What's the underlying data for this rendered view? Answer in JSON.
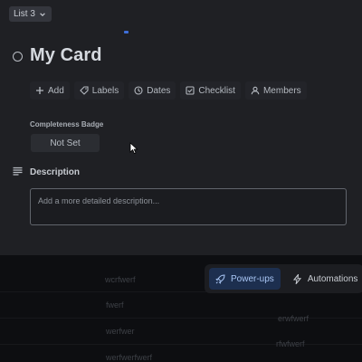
{
  "header": {
    "list_label": "List 3"
  },
  "card": {
    "title": "My Card"
  },
  "actions": [
    {
      "label": "Add",
      "icon": "plus-icon"
    },
    {
      "label": "Labels",
      "icon": "tag-icon"
    },
    {
      "label": "Dates",
      "icon": "clock-icon"
    },
    {
      "label": "Checklist",
      "icon": "checkbox-icon"
    },
    {
      "label": "Members",
      "icon": "person-icon"
    }
  ],
  "completeness": {
    "label": "Completeness Badge",
    "value": "Not Set"
  },
  "description": {
    "heading": "Description",
    "placeholder": "Add a more detailed description..."
  },
  "board_background": {
    "texts": [
      "wcrfwerf",
      "fwerf",
      "werfwer",
      "werfwerfwerf",
      "erwfwerf",
      "rfwfwerf"
    ]
  },
  "bottom_bar": {
    "powerups_label": "Power-ups",
    "automations_label": "Automations"
  },
  "colors": {
    "accent": "#3f6fd9",
    "active_button_bg": "#1d2f4f",
    "active_button_text": "#a9c6f5"
  }
}
